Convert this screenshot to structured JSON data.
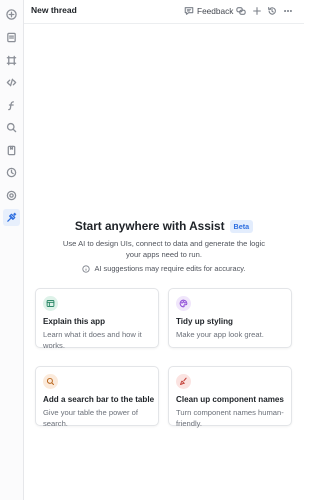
{
  "header": {
    "title": "New thread",
    "feedback_label": "Feedback"
  },
  "hero": {
    "title": "Start anywhere with Assist",
    "badge": "Beta",
    "subtitle": "Use AI to design UIs, connect to data and generate the logic your apps need to run.",
    "note": "AI suggestions may require edits for accuracy."
  },
  "cards": [
    {
      "title": "Explain this app",
      "description": "Learn what it does and how it works.",
      "icon": "layout-icon",
      "accent": "#2f8a6a",
      "bg": "#def2e9"
    },
    {
      "title": "Tidy up styling",
      "description": "Make your app look great.",
      "icon": "palette-icon",
      "accent": "#8a45d6",
      "bg": "#f0e6fb"
    },
    {
      "title": "Add a search bar to the table",
      "description": "Give your table the power of search.",
      "icon": "search-icon",
      "accent": "#b8651b",
      "bg": "#fbeadb"
    },
    {
      "title": "Clean up component names",
      "description": "Turn component names human-friendly.",
      "icon": "broom-icon",
      "accent": "#c2413a",
      "bg": "#fbe3e1"
    }
  ],
  "colors": {
    "accent": "#2f6fe0",
    "badge_bg": "#e3edfd"
  }
}
